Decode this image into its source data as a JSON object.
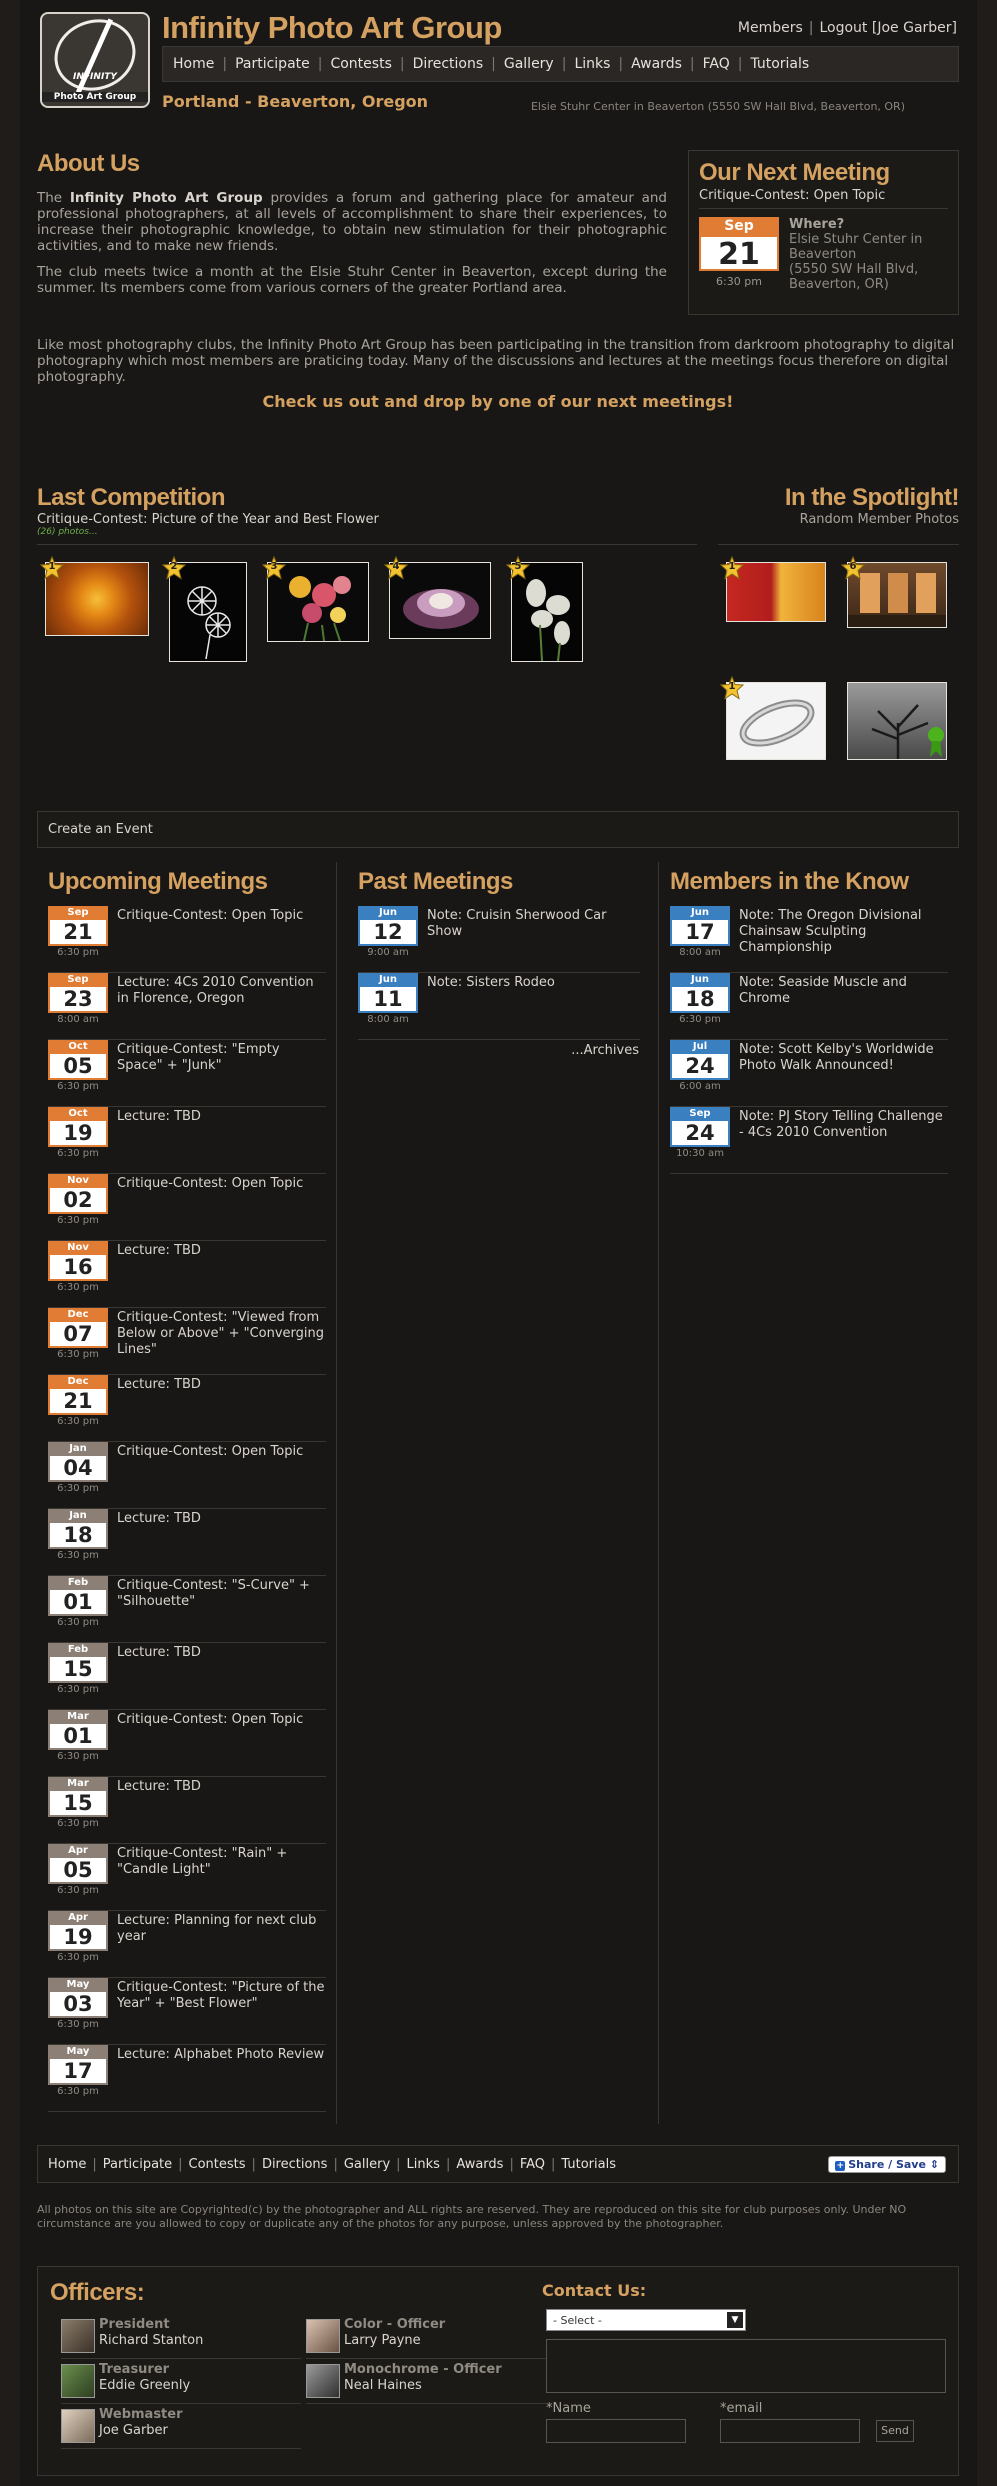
{
  "header": {
    "site_title": "Infinity Photo Art Group",
    "logo_text_1": "INFINITY",
    "logo_text_2": "Photo Art Group",
    "members_link": "Members",
    "logout_link": "Logout",
    "user": "[Joe Garber]",
    "nav": [
      "Home",
      "Participate",
      "Contests",
      "Directions",
      "Gallery",
      "Links",
      "Awards",
      "FAQ",
      "Tutorials"
    ],
    "tagline": "Portland - Beaverton, Oregon",
    "address": "Elsie Stuhr Center in Beaverton (5550 SW Hall Blvd, Beaverton, OR)"
  },
  "about": {
    "heading": "About Us",
    "p1_bold": "Infinity Photo Art Group",
    "p1_pre": "The ",
    "p1_post": " provides a forum and gathering place for amateur and professional photographers, at all levels of accomplishment to share their experiences, to increase their photographic knowledge, to obtain new stimulation for their photographic activities, and to make new friends.",
    "p2": "The club meets twice a month at the Elsie Stuhr Center in Beaverton, except during the summer. Its members come from various corners of the greater Portland area.",
    "p3": "Like most photography clubs, the Infinity Photo Art Group has been participating in the transition from darkroom photography to digital photography which most members are praticing today. Many of the discussions and lectures at the meetings focus therefore on digital photography.",
    "cta": "Check us out and drop by one of our next meetings!"
  },
  "next_meeting": {
    "heading": "Our Next Meeting",
    "title": "Critique-Contest: Open Topic",
    "month": "Sep",
    "day": "21",
    "time": "6:30 pm",
    "where_label": "Where?",
    "where_1": "Elsie Stuhr Center in Beaverton",
    "where_2": "(5550 SW Hall Blvd, Beaverton, OR)"
  },
  "last_competition": {
    "heading": "Last Competition",
    "subtitle": "Critique-Contest: Picture of the Year and Best Flower",
    "count": "(26) photos...",
    "ranks": [
      "1",
      "2",
      "3",
      "4",
      "5"
    ]
  },
  "spotlight": {
    "heading": "In the Spotlight!",
    "subtitle": "Random Member Photos",
    "ranks": [
      "1",
      "6",
      "1"
    ]
  },
  "create_event": "Create an Event",
  "upcoming": {
    "heading": "Upcoming Meetings",
    "items": [
      {
        "month": "Sep",
        "day": "21",
        "time": "6:30 pm",
        "title": "Critique-Contest: Open Topic"
      },
      {
        "month": "Sep",
        "day": "23",
        "time": "8:00 am",
        "title": "Lecture: 4Cs 2010 Convention in Florence, Oregon"
      },
      {
        "month": "Oct",
        "day": "05",
        "time": "6:30 pm",
        "title": "Critique-Contest: \"Empty Space\" + \"Junk\""
      },
      {
        "month": "Oct",
        "day": "19",
        "time": "6:30 pm",
        "title": "Lecture: TBD"
      },
      {
        "month": "Nov",
        "day": "02",
        "time": "6:30 pm",
        "title": "Critique-Contest: Open Topic"
      },
      {
        "month": "Nov",
        "day": "16",
        "time": "6:30 pm",
        "title": "Lecture: TBD"
      },
      {
        "month": "Dec",
        "day": "07",
        "time": "6:30 pm",
        "title": "Critique-Contest: \"Viewed from Below or Above\" + \"Converging Lines\""
      },
      {
        "month": "Dec",
        "day": "21",
        "time": "6:30 pm",
        "title": "Lecture: TBD"
      },
      {
        "month": "Jan",
        "day": "04",
        "time": "6:30 pm",
        "title": "Critique-Contest: Open Topic"
      },
      {
        "month": "Jan",
        "day": "18",
        "time": "6:30 pm",
        "title": "Lecture: TBD"
      },
      {
        "month": "Feb",
        "day": "01",
        "time": "6:30 pm",
        "title": "Critique-Contest: \"S-Curve\" + \"Silhouette\""
      },
      {
        "month": "Feb",
        "day": "15",
        "time": "6:30 pm",
        "title": "Lecture: TBD"
      },
      {
        "month": "Mar",
        "day": "01",
        "time": "6:30 pm",
        "title": "Critique-Contest: Open Topic"
      },
      {
        "month": "Mar",
        "day": "15",
        "time": "6:30 pm",
        "title": "Lecture: TBD"
      },
      {
        "month": "Apr",
        "day": "05",
        "time": "6:30 pm",
        "title": "Critique-Contest: \"Rain\" + \"Candle Light\""
      },
      {
        "month": "Apr",
        "day": "19",
        "time": "6:30 pm",
        "title": "Lecture: Planning for next club year"
      },
      {
        "month": "May",
        "day": "03",
        "time": "6:30 pm",
        "title": "Critique-Contest: \"Picture of the Year\" + \"Best Flower\""
      },
      {
        "month": "May",
        "day": "17",
        "time": "6:30 pm",
        "title": "Lecture: Alphabet Photo Review"
      }
    ]
  },
  "past": {
    "heading": "Past Meetings",
    "items": [
      {
        "month": "Jun",
        "day": "12",
        "time": "9:00 am",
        "title": "Note: Cruisin Sherwood Car Show"
      },
      {
        "month": "Jun",
        "day": "11",
        "time": "8:00 am",
        "title": "Note: Sisters Rodeo"
      }
    ],
    "archives": "...Archives"
  },
  "know": {
    "heading": "Members in the Know",
    "items": [
      {
        "month": "Jun",
        "day": "17",
        "time": "8:00 am",
        "title": "Note: The Oregon Divisional Chainsaw Sculpting Championship"
      },
      {
        "month": "Jun",
        "day": "18",
        "time": "6:30 pm",
        "title": "Note: Seaside Muscle and Chrome"
      },
      {
        "month": "Jul",
        "day": "24",
        "time": "6:00 am",
        "title": "Note: Scott Kelby's Worldwide Photo Walk Announced!"
      },
      {
        "month": "Sep",
        "day": "24",
        "time": "10:30 am",
        "title": "Note: PJ Story Telling Challenge - 4Cs 2010 Convention"
      }
    ]
  },
  "footer": {
    "nav": [
      "Home",
      "Participate",
      "Contests",
      "Directions",
      "Gallery",
      "Links",
      "Awards",
      "FAQ",
      "Tutorials"
    ],
    "share": "Share / Save",
    "copyright": "All photos on this site are Copyrighted(c) by the photographer and ALL rights are reserved. They are reproduced on this site for club purposes only. Under NO circumstance are you allowed to copy or duplicate any of the photos for any purpose, unless approved by the photographer."
  },
  "officers": {
    "heading": "Officers:",
    "list": [
      {
        "role": "President",
        "name": "Richard Stanton"
      },
      {
        "role": "Color - Officer",
        "name": "Larry Payne"
      },
      {
        "role": "Treasurer",
        "name": "Eddie Greenly"
      },
      {
        "role": "Monochrome - Officer",
        "name": "Neal Haines"
      },
      {
        "role": "Webmaster",
        "name": "Joe Garber"
      }
    ]
  },
  "contact": {
    "heading": "Contact Us:",
    "select": "- Select -",
    "name_label": "*Name",
    "email_label": "*email",
    "send": "Send"
  },
  "colors": {
    "accent": "#d4a161",
    "calendar_orange": "#e07c33",
    "calendar_blue": "#3a7fc0",
    "calendar_gray": "#8b7f76"
  }
}
